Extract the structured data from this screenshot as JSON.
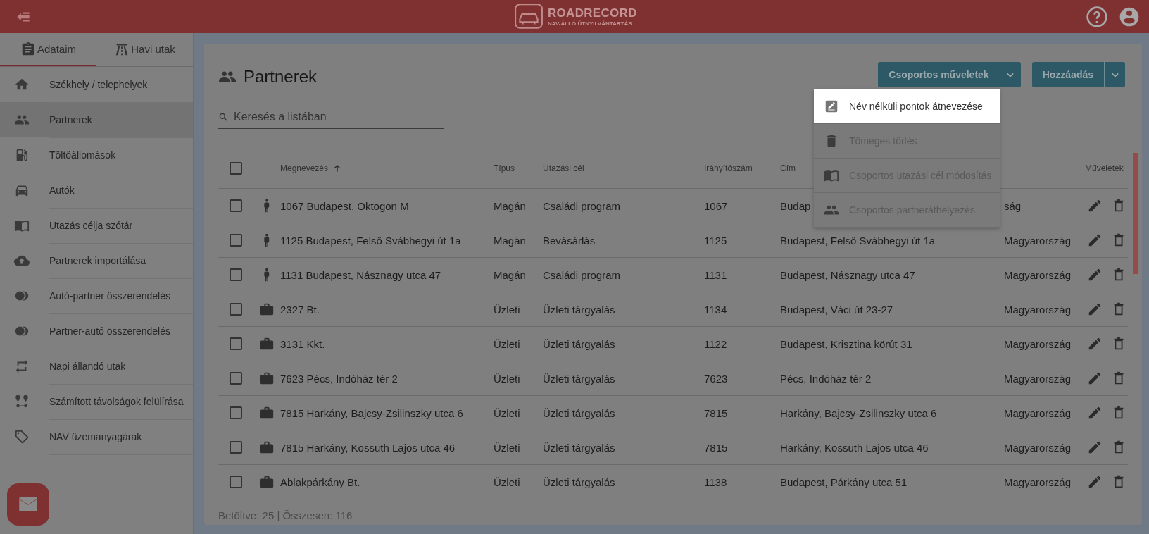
{
  "header": {
    "logo_title": "ROADRECORD",
    "logo_subtitle": "NAV-ÁLLÓ ÚTNYILVÁNTARTÁS"
  },
  "sidebar": {
    "tabs": [
      {
        "label": "Adataim",
        "selected": true
      },
      {
        "label": "Havi utak",
        "selected": false
      }
    ],
    "items": [
      {
        "label": "Székhely / telephelyek",
        "selected": false
      },
      {
        "label": "Partnerek",
        "selected": true
      },
      {
        "label": "Töltőállomások",
        "selected": false
      },
      {
        "label": "Autók",
        "selected": false
      },
      {
        "label": "Utazás célja szótár",
        "selected": false
      },
      {
        "label": "Partnerek importálása",
        "selected": false
      },
      {
        "label": "Autó-partner összerendelés",
        "selected": false
      },
      {
        "label": "Partner-autó összerendelés",
        "selected": false
      },
      {
        "label": "Napi állandó utak",
        "selected": false
      },
      {
        "label": "Számított távolságok felülírása",
        "selected": false
      },
      {
        "label": "NAV üzemanyagárak",
        "selected": false
      }
    ]
  },
  "page": {
    "title": "Partnerek",
    "buttons": [
      {
        "label": "Csoportos műveletek"
      },
      {
        "label": "Hozzáadás"
      }
    ],
    "search": {
      "placeholder": "Keresés a listában"
    },
    "menu": [
      {
        "label": "Név nélküli pontok átnevezése",
        "selected": true
      },
      {
        "label": "Tömeges törlés",
        "selected": false
      },
      {
        "label": "Csoportos utazási cél módosítás",
        "selected": false
      },
      {
        "label": "Csoportos partneráthelyezés",
        "selected": false
      }
    ],
    "table": {
      "header_checked": false,
      "columns": [
        "Megnevezés",
        "Típus",
        "Utazási cél",
        "Irányítószám",
        "Cím",
        "Műveletek"
      ],
      "rows": [
        {
          "kind": "person",
          "checked": false,
          "name": "1067 Budapest, Oktogon M",
          "type": "Magán",
          "purpose": "Családi program",
          "zip": "1067",
          "address": "Budap",
          "country": "ság"
        },
        {
          "kind": "person",
          "checked": false,
          "name": "1125 Budapest, Felső Svábhegyi út 1a",
          "type": "Magán",
          "purpose": "Bevásárlás",
          "zip": "1125",
          "address": "Budapest, Felső Svábhegyi út 1a",
          "country": "Magyarország"
        },
        {
          "kind": "person",
          "checked": false,
          "name": "1131 Budapest, Násznagy utca 47",
          "type": "Magán",
          "purpose": "Családi program",
          "zip": "1131",
          "address": "Budapest, Násznagy utca 47",
          "country": "Magyarország"
        },
        {
          "kind": "business",
          "checked": false,
          "name": "2327 Bt.",
          "type": "Üzleti",
          "purpose": "Üzleti tárgyalás",
          "zip": "1134",
          "address": "Budapest, Váci út 23-27",
          "country": "Magyarország"
        },
        {
          "kind": "business",
          "checked": false,
          "name": "3131 Kkt.",
          "type": "Üzleti",
          "purpose": "Üzleti tárgyalás",
          "zip": "1122",
          "address": "Budapest, Krisztina körút 31",
          "country": "Magyarország"
        },
        {
          "kind": "business",
          "checked": false,
          "name": "7623 Pécs, Indóház tér 2",
          "type": "Üzleti",
          "purpose": "Üzleti tárgyalás",
          "zip": "7623",
          "address": "Pécs, Indóház tér 2",
          "country": "Magyarország"
        },
        {
          "kind": "business",
          "checked": false,
          "name": "7815 Harkány, Bajcsy-Zsilinszky utca 6",
          "type": "Üzleti",
          "purpose": "Üzleti tárgyalás",
          "zip": "7815",
          "address": "Harkány, Bajcsy-Zsilinszky utca 6",
          "country": "Magyarország"
        },
        {
          "kind": "business",
          "checked": false,
          "name": "7815 Harkány, Kossuth Lajos utca 46",
          "type": "Üzleti",
          "purpose": "Üzleti tárgyalás",
          "zip": "7815",
          "address": "Harkány, Kossuth Lajos utca 46",
          "country": "Magyarország"
        },
        {
          "kind": "business",
          "checked": false,
          "name": "Ablakpárkány Bt.",
          "type": "Üzleti",
          "purpose": "Üzleti tárgyalás",
          "zip": "1138",
          "address": "Budapest, Párkány utca 51",
          "country": "Magyarország"
        }
      ]
    },
    "footer": "Betöltve: 25 | Összesen: 116"
  }
}
